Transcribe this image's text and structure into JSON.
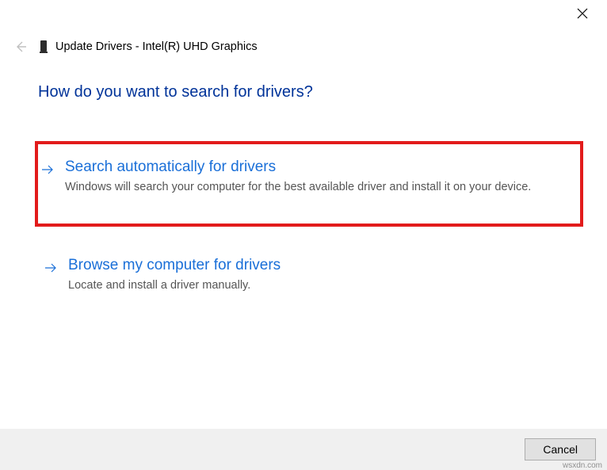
{
  "window": {
    "title": "Update Drivers - Intel(R) UHD Graphics"
  },
  "main": {
    "question": "How do you want to search for drivers?",
    "options": [
      {
        "title": "Search automatically for drivers",
        "description": "Windows will search your computer for the best available driver and install it on your device."
      },
      {
        "title": "Browse my computer for drivers",
        "description": "Locate and install a driver manually."
      }
    ]
  },
  "footer": {
    "cancel_label": "Cancel"
  },
  "watermark": "wsxdn.com"
}
